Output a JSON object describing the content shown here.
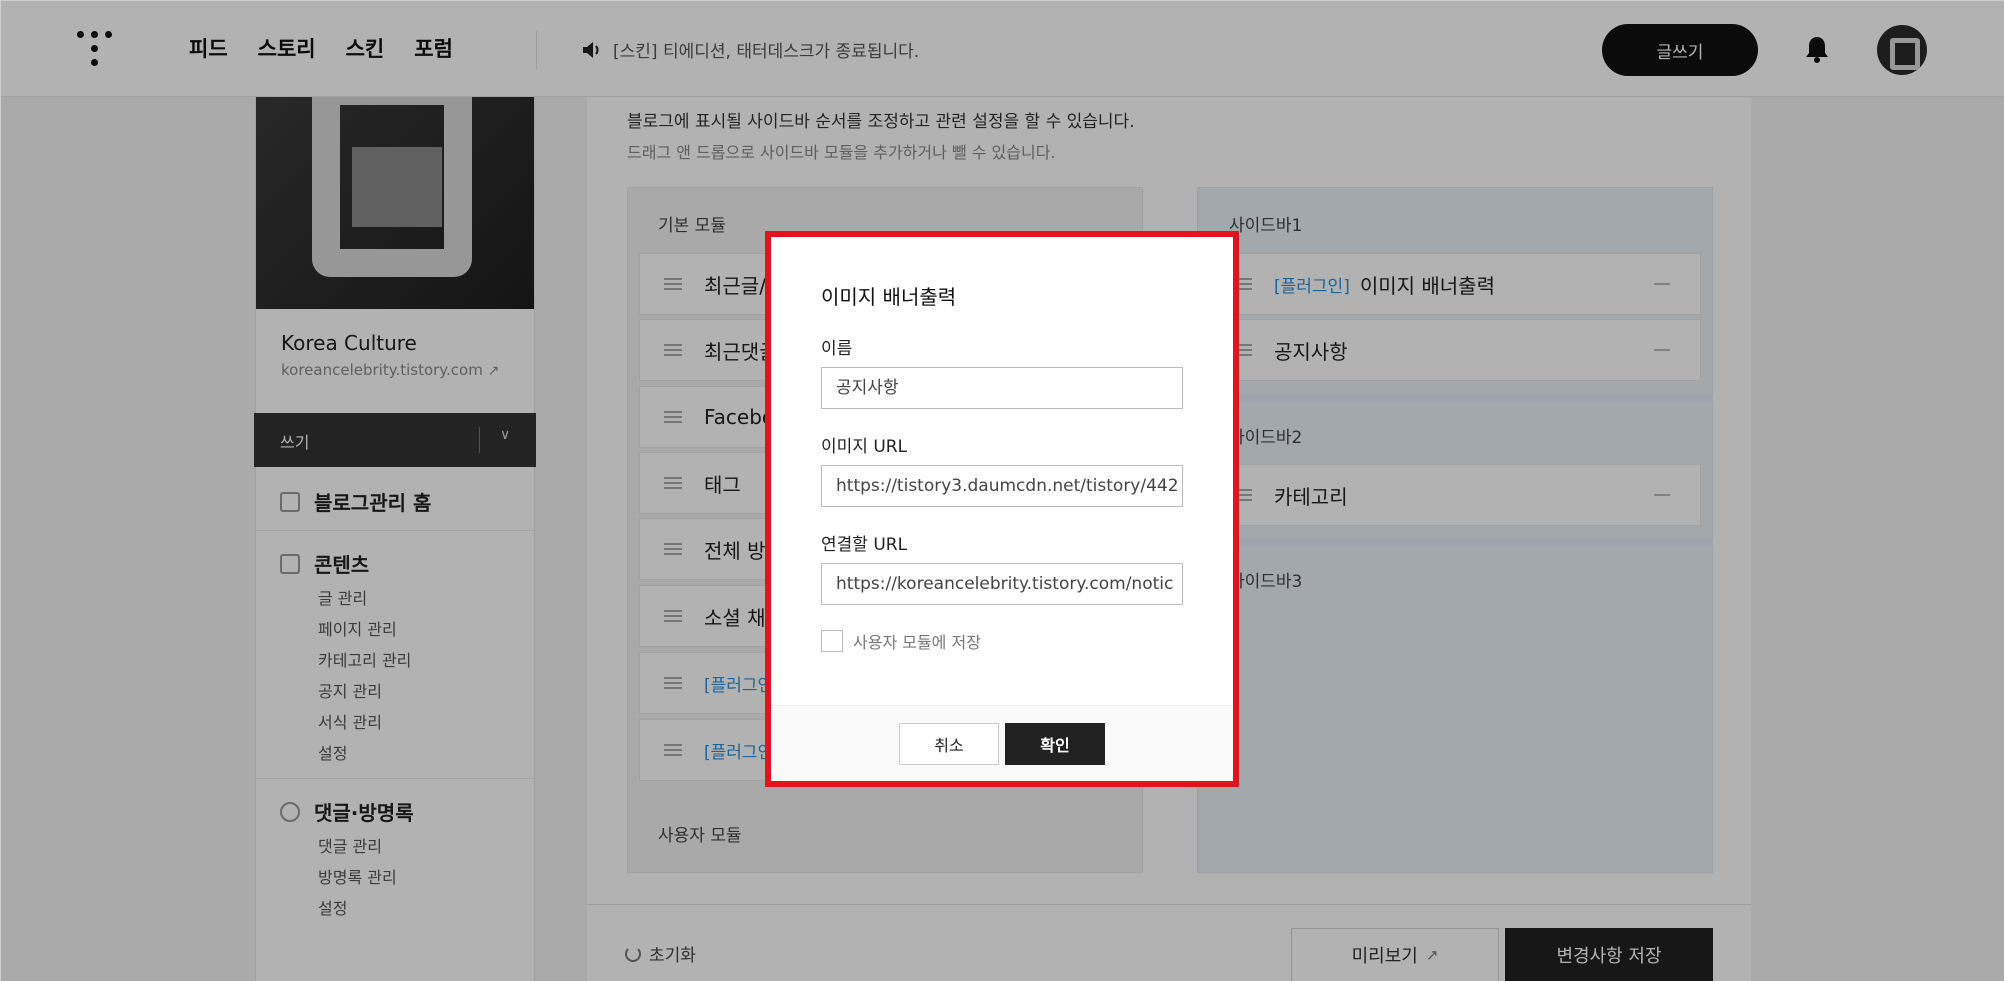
{
  "nav": {
    "items": [
      "피드",
      "스토리",
      "스킨",
      "포럼"
    ],
    "notice": "[스킨] 티에디션, 태터데스크가 종료됩니다.",
    "write_label": "글쓰기"
  },
  "sidebar": {
    "blog_name": "Korea Culture",
    "blog_url": "koreancelebrity.tistory.com",
    "write_label": "쓰기",
    "sections": [
      {
        "title": "블로그관리 홈",
        "items": []
      },
      {
        "title": "콘텐츠",
        "items": [
          "글 관리",
          "페이지 관리",
          "카테고리 관리",
          "공지 관리",
          "서식 관리",
          "설정"
        ]
      },
      {
        "title": "댓글·방명록",
        "items": [
          "댓글 관리",
          "방명록 관리",
          "설정"
        ]
      }
    ]
  },
  "main": {
    "desc1": "블로그에 표시될 사이드바 순서를 조정하고 관련 설정을 할 수 있습니다.",
    "desc2": "드래그 앤 드롭으로 사이드바 모듈을 추가하거나 뺄 수 있습니다.",
    "basic_title": "기본 모듈",
    "basic_modules": [
      "최근글/",
      "최근댓글",
      "Facebo",
      "태그",
      "전체 방",
      "소셜 채",
      "[플러그인",
      "[플러그인"
    ],
    "user_title": "사용자 모듈",
    "sidebar1_title": "사이드바1",
    "sidebar1_items": [
      {
        "plugin": "[플러그인]",
        "label": "이미지 배너출력"
      },
      {
        "plugin": "",
        "label": "공지사항"
      }
    ],
    "sidebar2_title": "사이드바2",
    "sidebar2_items": [
      {
        "plugin": "",
        "label": "카테고리"
      }
    ],
    "sidebar3_title": "사이드바3",
    "reset_label": "초기화",
    "preview_label": "미리보기",
    "save_label": "변경사항 저장"
  },
  "modal": {
    "title": "이미지 배너출력",
    "name_label": "이름",
    "name_value": "공지사항",
    "image_url_label": "이미지 URL",
    "image_url_value": "https://tistory3.daumcdn.net/tistory/442",
    "link_url_label": "연결할 URL",
    "link_url_value": "https://koreancelebrity.tistory.com/notic",
    "save_user_module_label": "사용자 모듈에 저장",
    "cancel_label": "취소",
    "ok_label": "확인",
    "highlight_color": "#e1141c"
  }
}
